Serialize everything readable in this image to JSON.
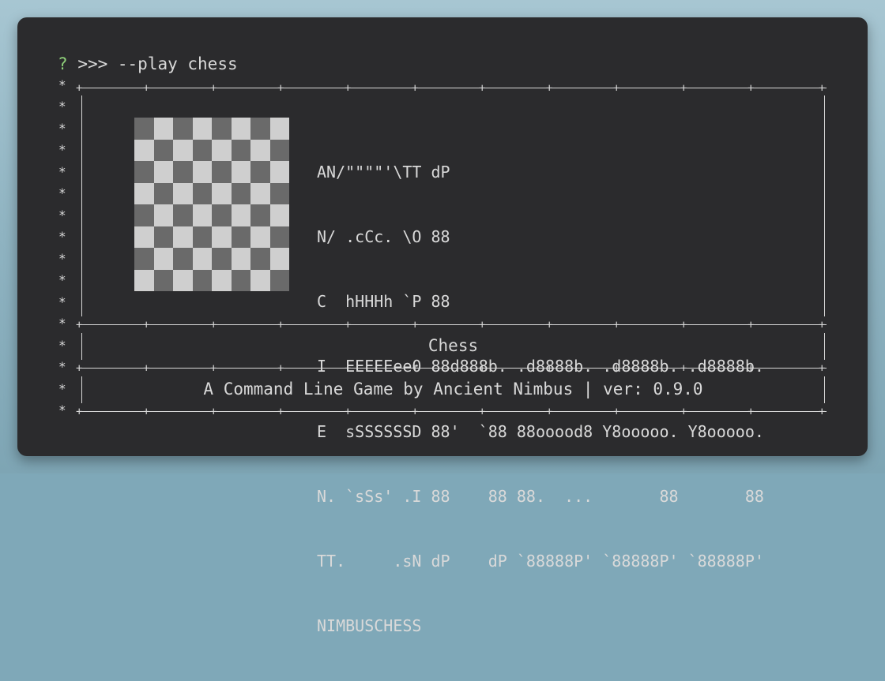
{
  "terminal": {
    "prompt_symbol": "?",
    "command": ">>> --play chess"
  },
  "banner": {
    "ascii_art": [
      "AN/\"\"\"\"'\\TT dP",
      "N/ .cCc. \\O 88",
      "C  hHHHh `P 88",
      "I  EEEEEee0 88d888b. .d8888b. .d8888b. .d8888b.",
      "E  sSSSSSSD 88'  `88 88ooood8 Y8ooooo. Y8ooooo.",
      "N. `sSs' .I 88    88 88.  ...       88       88",
      "TT.     .sN dP    dP `88888P' `88888P' `88888P'",
      "NIMBUSCHESS"
    ],
    "title": "Chess",
    "subtitle": "A Command Line Game by Ancient Nimbus | ver: 0.9.0"
  },
  "colors": {
    "background": "#2b2b2d",
    "text": "#d9d9d9",
    "prompt_symbol": "#8fd07a",
    "board_light": "#cfcfcf",
    "board_dark": "#6a6a6a"
  }
}
